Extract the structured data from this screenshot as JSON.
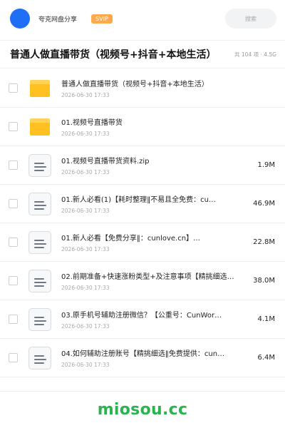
{
  "header": {
    "share_name": "夸克网盘分享",
    "badge": "SVIP",
    "search_placeholder": "搜索"
  },
  "title_bar": {
    "title": "普通人做直播带货（视频号+抖音+本地生活）",
    "meta": "共 104 项 · 4.5G"
  },
  "files": [
    {
      "type": "folder",
      "name": "普通人做直播带货（视频号+抖音+本地生活）",
      "date": "2026-06-30 17:33",
      "size": ""
    },
    {
      "type": "folder",
      "name": "01.视频号直播带货",
      "date": "2026-06-30 17:33",
      "size": ""
    },
    {
      "type": "file",
      "name": "01.视频号直播带货资料.zip",
      "date": "2026-06-30 17:33",
      "size": "1.9M"
    },
    {
      "type": "file",
      "name": "01.新人必看(1)【耗时整理‖不易且全免费：cu…",
      "date": "2026-06-30 17:33",
      "size": "46.9M"
    },
    {
      "type": "file",
      "name": "01.新人必看【免费分享‖：cunlove.cn】…",
      "date": "2026-06-30 17:33",
      "size": "22.8M"
    },
    {
      "type": "file",
      "name": "02.前期准备+快速涨粉类型+及注意事项【精挑细选…",
      "date": "2026-06-30 17:33",
      "size": "38.0M"
    },
    {
      "type": "file",
      "name": "03.原手机号辅助注册微信？【公重号：CunWor…",
      "date": "2026-06-30 17:33",
      "size": "4.1M"
    },
    {
      "type": "file",
      "name": "04.如何辅助注册账号【精挑细选‖免费提供：cun…",
      "date": "2026-06-30 17:33",
      "size": "6.4M"
    }
  ],
  "footer": {
    "brand": "miosou.cc"
  },
  "colors": {
    "avatar": "#1e6ff5",
    "svip": "#ffa94d",
    "folder": "#ffc021",
    "brand": "#2ab450"
  },
  "icons": {
    "folder": "folder-icon",
    "file": "document-icon"
  }
}
